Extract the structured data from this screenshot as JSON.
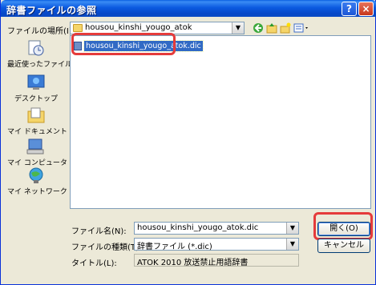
{
  "title": "辞書ファイルの参照",
  "titlebar": {
    "help": "?",
    "close": "×"
  },
  "lookin": {
    "label": "ファイルの場所(I):",
    "value": "housou_kinshi_yougo_atok"
  },
  "places": [
    {
      "label": "最近使ったファイル",
      "icon": "recent-docs-icon"
    },
    {
      "label": "デスクトップ",
      "icon": "desktop-icon"
    },
    {
      "label": "マイ ドキュメント",
      "icon": "my-documents-icon"
    },
    {
      "label": "マイ コンピュータ",
      "icon": "my-computer-icon"
    },
    {
      "label": "マイ ネットワーク",
      "icon": "my-network-icon"
    }
  ],
  "files": [
    {
      "name": "housou_kinshi_yougo_atok.dic",
      "selected": true
    }
  ],
  "filename": {
    "label": "ファイル名(N):",
    "value": "housou_kinshi_yougo_atok.dic"
  },
  "filetype": {
    "label": "ファイルの種類(T):",
    "value": "辞書ファイル (*.dic)"
  },
  "titlefield": {
    "label": "タイトル(L):",
    "value": "ATOK 2010 放送禁止用語辞書"
  },
  "buttons": {
    "open": "開く(O)",
    "cancel": "キャンセル"
  },
  "colors": {
    "titlebar": "#0a5fe0",
    "selection": "#316ac5",
    "highlight": "#e53b3b"
  }
}
